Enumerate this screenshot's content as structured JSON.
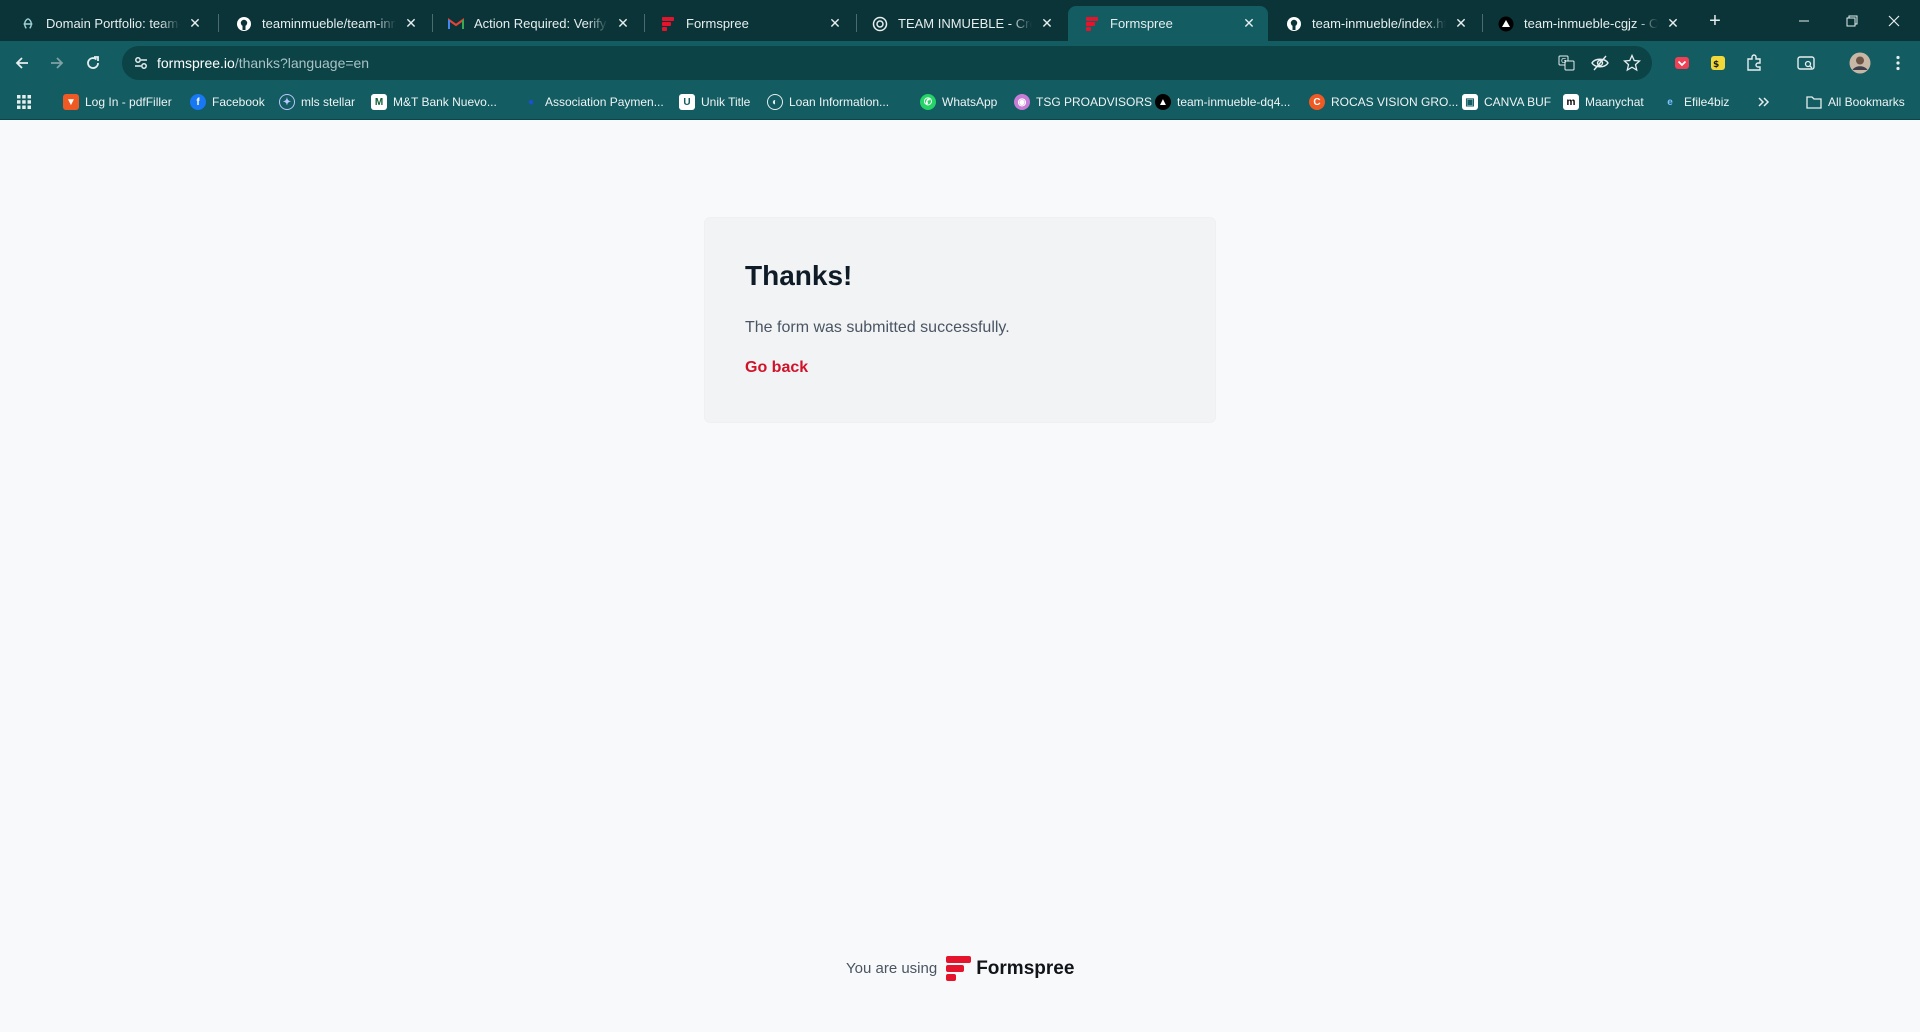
{
  "browser": {
    "tabs": [
      {
        "title": "Domain Portfolio: team-in",
        "icon": "domain-icon",
        "active": false
      },
      {
        "title": "teaminmueble/team-inmu",
        "icon": "github-icon",
        "active": false
      },
      {
        "title": "Action Required: Verify em",
        "icon": "gmail-icon",
        "active": false
      },
      {
        "title": "Formspree",
        "icon": "formspree-icon",
        "active": false
      },
      {
        "title": "TEAM INMUEBLE - Crear p",
        "icon": "globe-icon",
        "active": false
      },
      {
        "title": "Formspree",
        "icon": "formspree-icon",
        "active": true
      },
      {
        "title": "team-inmueble/index.htm",
        "icon": "github-icon",
        "active": false
      },
      {
        "title": "team-inmueble-cgjz - Ove",
        "icon": "vercel-icon",
        "active": false
      }
    ],
    "address": {
      "host": "formspree.io",
      "path": "/thanks?language=en"
    },
    "bookmarks": [
      {
        "label": "Log In - pdfFiller"
      },
      {
        "label": "Facebook"
      },
      {
        "label": "mls stellar"
      },
      {
        "label": "M&T Bank Nuevo..."
      },
      {
        "label": "Association Paymen..."
      },
      {
        "label": "Unik Title"
      },
      {
        "label": "Loan Information..."
      },
      {
        "label": "WhatsApp"
      },
      {
        "label": "TSG PROADVISORS"
      },
      {
        "label": "team-inmueble-dq4..."
      },
      {
        "label": "ROCAS VISION GRO..."
      },
      {
        "label": "CANVA BUF"
      },
      {
        "label": "Maanychat"
      },
      {
        "label": "Efile4biz"
      }
    ],
    "all_bookmarks_label": "All Bookmarks"
  },
  "page": {
    "heading": "Thanks!",
    "message": "The form was submitted successfully.",
    "go_back": "Go back",
    "footer_using": "You are using",
    "footer_brand": "Formspree"
  },
  "colors": {
    "accent": "#d1132a",
    "frame": "#0b3438",
    "toolbar": "#135c62"
  }
}
